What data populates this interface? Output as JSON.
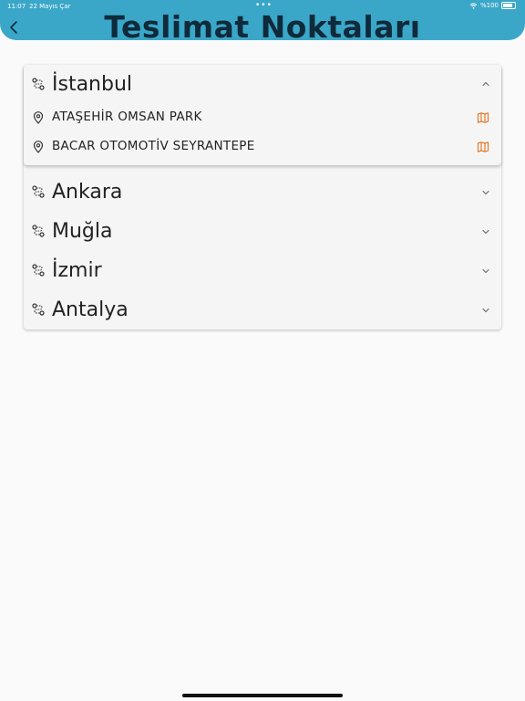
{
  "status_bar": {
    "time": "11:07",
    "date": "22 Mayıs Çar",
    "battery": "%100"
  },
  "header": {
    "title": "Teslimat Noktaları",
    "back_icon": "chevron-left-icon",
    "background_color": "#3aa7c9"
  },
  "cities": [
    {
      "name": "İstanbul",
      "expanded": true,
      "locations": [
        {
          "name": "ATAŞEHİR OMSAN PARK"
        },
        {
          "name": "BACAR OTOMOTİV SEYRANTEPE"
        }
      ]
    },
    {
      "name": "Ankara",
      "expanded": false
    },
    {
      "name": "Muğla",
      "expanded": false
    },
    {
      "name": "İzmir",
      "expanded": false
    },
    {
      "name": "Antalya",
      "expanded": false
    }
  ],
  "colors": {
    "map_icon": "#e07a2c",
    "text": "#222222"
  }
}
